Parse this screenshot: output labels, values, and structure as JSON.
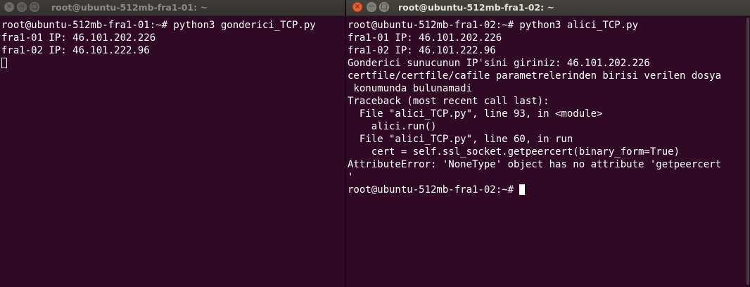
{
  "window1": {
    "title": "root@ubuntu-512mb-fra1-01: ~",
    "close_glyph": "×",
    "min_glyph": "−",
    "max_glyph": "□",
    "lines": [
      "root@ubuntu-512mb-fra1-01:~# python3 gonderici_TCP.py",
      "fra1-01 IP: 46.101.202.226",
      "fra1-02 IP: 46.101.222.96"
    ]
  },
  "window2": {
    "title": "root@ubuntu-512mb-fra1-02: ~",
    "close_glyph": "×",
    "min_glyph": "−",
    "max_glyph": "□",
    "lines": [
      "root@ubuntu-512mb-fra1-02:~# python3 alici_TCP.py",
      "fra1-01 IP: 46.101.202.226",
      "fra1-02 IP: 46.101.222.96",
      "Gonderici sunucunun IP'sini giriniz: 46.101.202.226",
      "certfile/certfile/cafile parametrelerinden birisi verilen dosya",
      " konumunda bulunamadi",
      "Traceback (most recent call last):",
      "  File \"alici_TCP.py\", line 93, in <module>",
      "    alici.run()",
      "  File \"alici_TCP.py\", line 60, in run",
      "    cert = self.ssl_socket.getpeercert(binary_form=True)",
      "AttributeError: 'NoneType' object has no attribute 'getpeercert",
      "'",
      "root@ubuntu-512mb-fra1-02:~# "
    ]
  }
}
